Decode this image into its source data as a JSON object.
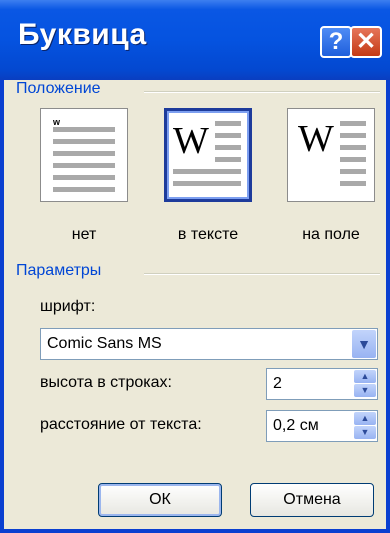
{
  "window": {
    "title": "Буквица",
    "help_glyph": "?",
    "close_glyph": "✕"
  },
  "position": {
    "group_label": "Положение",
    "options": [
      {
        "label": "нет",
        "selected": false
      },
      {
        "label": "в тексте",
        "selected": true
      },
      {
        "label": "на поле",
        "selected": false
      }
    ],
    "dropcap_letter": "W",
    "small_letter": "w"
  },
  "params": {
    "group_label": "Параметры",
    "font_label": "шрифт:",
    "font_value": "Comic Sans MS",
    "lines_label": "высота в строках:",
    "lines_value": "2",
    "distance_label": "расстояние от текста:",
    "distance_value": "0,2 см"
  },
  "buttons": {
    "ok": "ОК",
    "cancel": "Отмена"
  },
  "icons": {
    "dropdown": "chevron-down-icon",
    "spin_up": "arrow-up-icon",
    "spin_down": "arrow-down-icon"
  }
}
